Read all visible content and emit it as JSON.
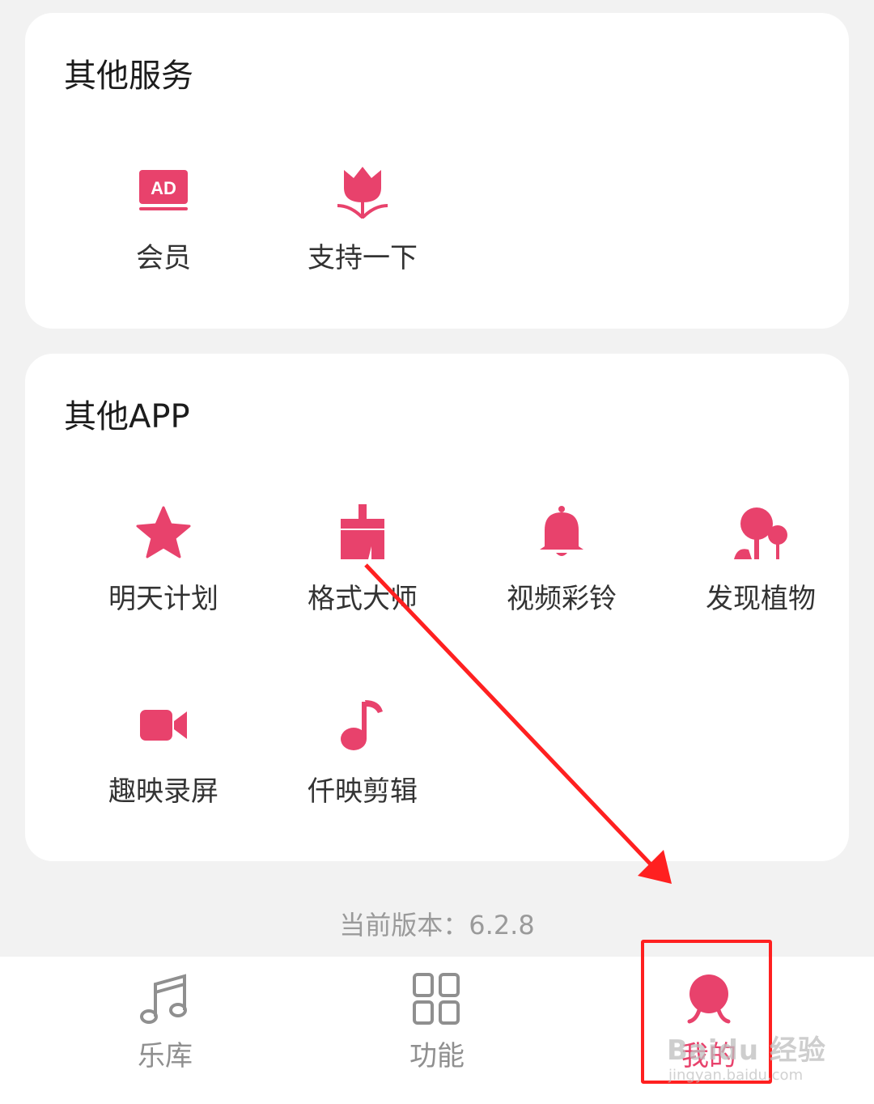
{
  "accent_color": "#e8426c",
  "services": {
    "title": "其他服务",
    "items": [
      {
        "label": "会员",
        "icon": "ad-icon"
      },
      {
        "label": "支持一下",
        "icon": "tulip-icon"
      }
    ]
  },
  "apps": {
    "title": "其他APP",
    "items": [
      {
        "label": "明天计划",
        "icon": "star-icon"
      },
      {
        "label": "格式大师",
        "icon": "broom-icon"
      },
      {
        "label": "视频彩铃",
        "icon": "bell-icon"
      },
      {
        "label": "发现植物",
        "icon": "tree-icon"
      },
      {
        "label": "趣映录屏",
        "icon": "video-camera-icon"
      },
      {
        "label": "仟映剪辑",
        "icon": "music-note-icon"
      }
    ]
  },
  "version_text": "当前版本：6.2.8",
  "bottom_nav": {
    "items": [
      {
        "label": "乐库",
        "icon": "music-notes-icon"
      },
      {
        "label": "功能",
        "icon": "grid-icon"
      },
      {
        "label": "我的",
        "icon": "profile-icon",
        "active": true
      }
    ]
  },
  "watermark": {
    "brand": "Baidu 经验",
    "url": "jingyan.baidu.com"
  }
}
